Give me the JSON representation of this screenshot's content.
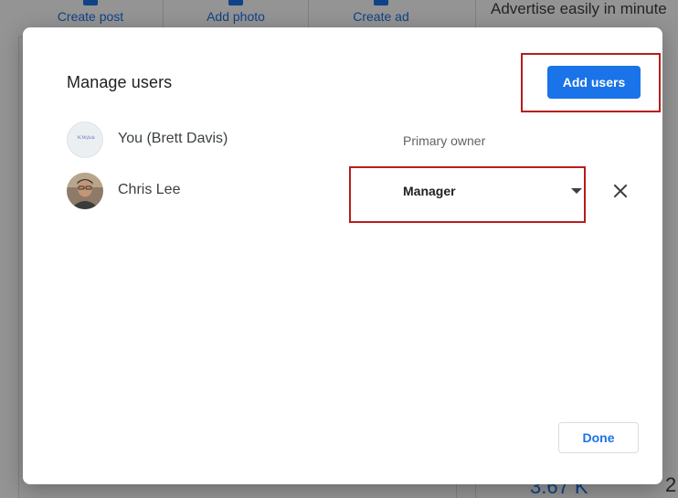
{
  "background": {
    "actions": [
      {
        "label": "Create post",
        "icon": "post-icon"
      },
      {
        "label": "Add photo",
        "icon": "photo-icon"
      },
      {
        "label": "Create ad",
        "icon": "ad-icon"
      }
    ],
    "right_panel_title": "Advertise easily in minute",
    "bottom_value": "3.67 K",
    "bottom_value_2": "2"
  },
  "dialog": {
    "title": "Manage users",
    "add_users_label": "Add users",
    "done_label": "Done",
    "users": [
      {
        "name": "You (Brett Davis)",
        "role": "Primary owner",
        "avatar": "business-logo-avatar",
        "editable": false
      },
      {
        "name": "Chris Lee",
        "role": "Manager",
        "avatar": "photo-avatar",
        "editable": true
      }
    ]
  },
  "colors": {
    "primary": "#1a73e8",
    "highlight": "#b71c1c",
    "text": "#3c4043"
  }
}
